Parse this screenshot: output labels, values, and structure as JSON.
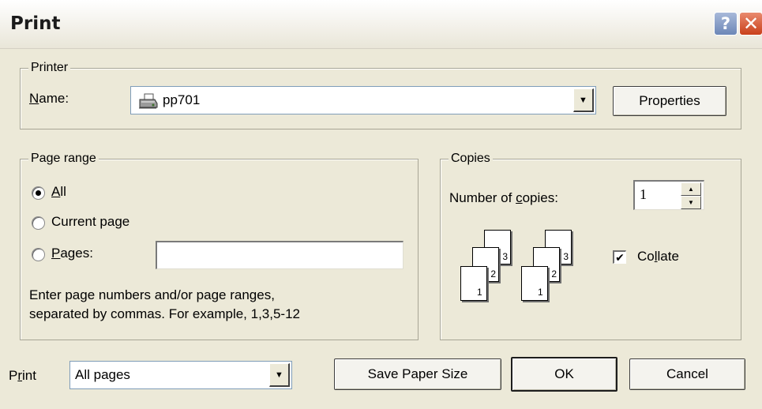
{
  "dialog": {
    "title": "Print",
    "help_glyph": "?",
    "close_glyph": "✕"
  },
  "printer": {
    "group_label": "Printer",
    "name_label_accel": "N",
    "name_label_rest": "ame:",
    "selected_printer": "pp701",
    "printer_icon": "printer-icon",
    "properties_label": "Properties"
  },
  "page_range": {
    "group_label": "Page range",
    "options": [
      {
        "accel": "A",
        "rest": "ll",
        "checked": true
      },
      {
        "pre": "Current pa",
        "accel": "g",
        "rest": "e",
        "checked": false
      },
      {
        "accel": "P",
        "rest": "ages:",
        "checked": false
      }
    ],
    "pages_value": "",
    "help_line1": "Enter page numbers and/or page ranges,",
    "help_line2": "separated by commas. For example, 1,3,5-12"
  },
  "copies": {
    "group_label": "Copies",
    "number_label_pre": "Number of ",
    "number_label_accel": "c",
    "number_label_rest": "opies:",
    "number_value": "1",
    "collate_pre": "Co",
    "collate_accel": "l",
    "collate_rest": "late",
    "collate_checked": true,
    "page_numbers": [
      "1",
      "2",
      "3"
    ]
  },
  "footer": {
    "print_label_pre": "P",
    "print_label_accel": "r",
    "print_label_rest": "int",
    "print_selected": "All pages",
    "save_paper_size_label": "Save Paper Size",
    "ok_label": "OK",
    "cancel_label": "Cancel"
  }
}
